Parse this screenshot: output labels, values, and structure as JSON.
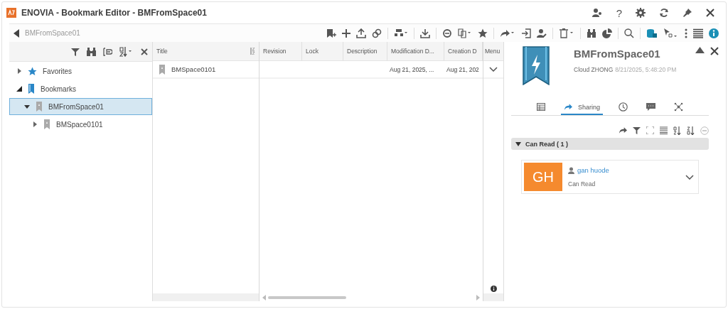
{
  "window": {
    "title": "ENOVIA - Bookmark Editor - BMFromSpace01",
    "help_label": "?"
  },
  "toolbar": {
    "breadcrumb": "BMFromSpace01"
  },
  "tree": {
    "items": [
      {
        "label": "Favorites",
        "kind": "favorites",
        "expanded": false,
        "selected": false
      },
      {
        "label": "Bookmarks",
        "kind": "root",
        "expanded": true,
        "selected": false,
        "children": [
          {
            "label": "BMFromSpace01",
            "kind": "bookmark",
            "expanded": true,
            "selected": true,
            "children": [
              {
                "label": "BMSpace0101",
                "kind": "bookmark",
                "expanded": false,
                "selected": false
              }
            ]
          }
        ]
      }
    ]
  },
  "table": {
    "columns": [
      "Title",
      "Revision",
      "Lock",
      "Description",
      "Modification D...",
      "Creation D",
      "Menu"
    ],
    "rows": [
      {
        "title": "BMSpace0101",
        "modification": "Aug 21, 2025, ...",
        "creation": "Aug 21, 202"
      }
    ]
  },
  "details": {
    "title": "BMFromSpace01",
    "author": "Cloud ZHONG",
    "date": "8/21/2025, 5:48:20 PM",
    "tabs": [
      {
        "kind": "properties",
        "selected": false
      },
      {
        "kind": "sharing",
        "label": "Sharing",
        "selected": true
      },
      {
        "kind": "history",
        "selected": false
      },
      {
        "kind": "comments",
        "selected": false
      },
      {
        "kind": "relations",
        "selected": false
      }
    ],
    "group": {
      "label": "Can Read ( 1 )",
      "expanded": true
    },
    "members": [
      {
        "initials": "GH",
        "name": "gan huode",
        "role": "Can Read"
      }
    ]
  }
}
